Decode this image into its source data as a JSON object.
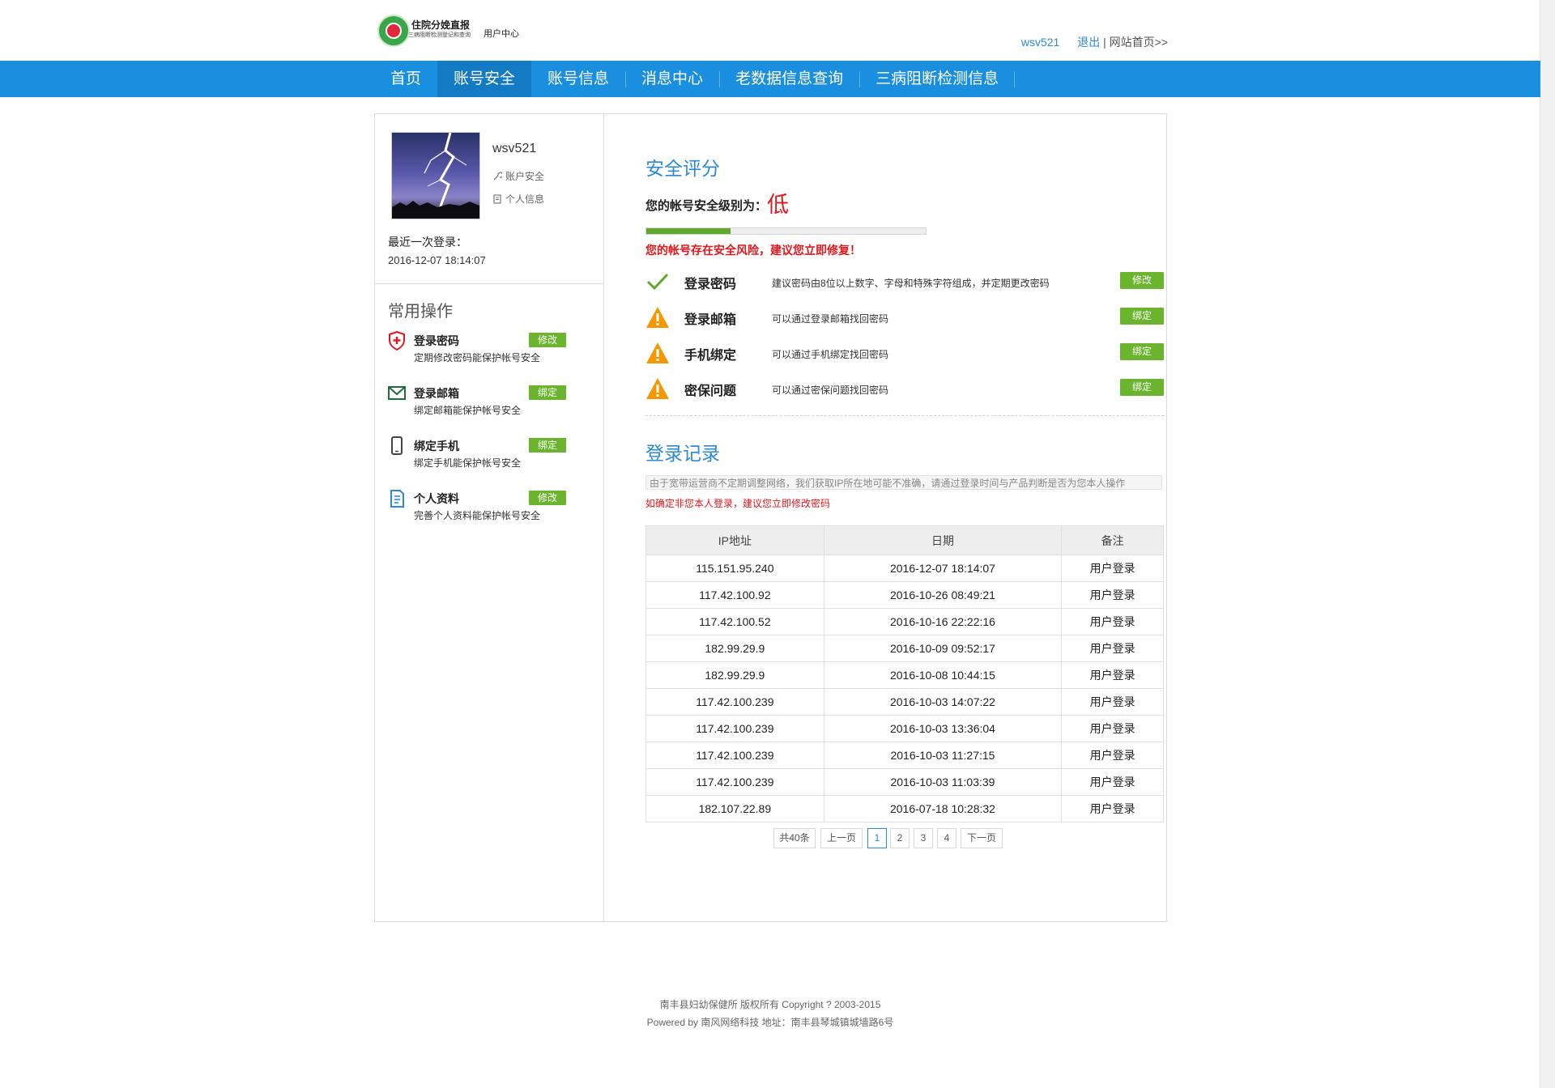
{
  "header": {
    "logo_title": "住院分娩直报",
    "logo_subtitle": "三病阻断检测登记和查询",
    "logo_center": "用户中心",
    "username": "wsv521",
    "logout": "退出",
    "separator": "|",
    "home_link": "网站首页>>"
  },
  "nav": {
    "items": [
      "首页",
      "账号安全",
      "账号信息",
      "消息中心",
      "老数据信息查询",
      "三病阻断检测信息"
    ],
    "active_index": 1
  },
  "sidebar": {
    "username": "wsv521",
    "account_security": "账户安全",
    "personal_info": "个人信息",
    "last_login_label": "最近一次登录：",
    "last_login_time": "2016-12-07 18:14:07",
    "ops_title": "常用操作",
    "ops": [
      {
        "name": "登录密码",
        "desc": "定期修改密码能保护帐号安全",
        "button": "修改",
        "icon": "shield-icon"
      },
      {
        "name": "登录邮箱",
        "desc": "绑定邮箱能保护帐号安全",
        "button": "绑定",
        "icon": "mail-icon"
      },
      {
        "name": "绑定手机",
        "desc": "绑定手机能保护帐号安全",
        "button": "绑定",
        "icon": "phone-icon"
      },
      {
        "name": "个人资料",
        "desc": "完善个人资料能保护帐号安全",
        "button": "修改",
        "icon": "document-icon"
      }
    ]
  },
  "security": {
    "title": "安全评分",
    "level_label": "您的帐号安全级别为：",
    "level_value": "低",
    "progress": 0.3,
    "warning": "您的帐号存在安全风险，建议您立即修复！",
    "items": [
      {
        "name": "登录密码",
        "desc": "建议密码由8位以上数字、字母和特殊字符组成，并定期更改密码",
        "button": "修改",
        "status": "ok"
      },
      {
        "name": "登录邮箱",
        "desc": "可以通过登录邮箱找回密码",
        "button": "绑定",
        "status": "warn"
      },
      {
        "name": "手机绑定",
        "desc": "可以通过手机绑定找回密码",
        "button": "绑定",
        "status": "warn"
      },
      {
        "name": "密保问题",
        "desc": "可以通过密保问题找回密码",
        "button": "绑定",
        "status": "warn"
      }
    ]
  },
  "login_log": {
    "title": "登录记录",
    "notice": "由于宽带运营商不定期调整网络，我们获取IP所在地可能不准确，请通过登录时间与产品判断是否为您本人操作",
    "notice2": "如确定非您本人登录，建议您立即修改密码",
    "columns": [
      "IP地址",
      "日期",
      "备注"
    ],
    "rows": [
      [
        "115.151.95.240",
        "2016-12-07 18:14:07",
        "用户登录"
      ],
      [
        "117.42.100.92",
        "2016-10-26 08:49:21",
        "用户登录"
      ],
      [
        "117.42.100.52",
        "2016-10-16 22:22:16",
        "用户登录"
      ],
      [
        "182.99.29.9",
        "2016-10-09 09:52:17",
        "用户登录"
      ],
      [
        "182.99.29.9",
        "2016-10-08 10:44:15",
        "用户登录"
      ],
      [
        "117.42.100.239",
        "2016-10-03 14:07:22",
        "用户登录"
      ],
      [
        "117.42.100.239",
        "2016-10-03 13:36:04",
        "用户登录"
      ],
      [
        "117.42.100.239",
        "2016-10-03 11:27:15",
        "用户登录"
      ],
      [
        "117.42.100.239",
        "2016-10-03 11:03:39",
        "用户登录"
      ],
      [
        "182.107.22.89",
        "2016-07-18 10:28:32",
        "用户登录"
      ]
    ],
    "pager": {
      "total": "共40条",
      "prev": "上一页",
      "pages": [
        "1",
        "2",
        "3",
        "4"
      ],
      "current": "1",
      "next": "下一页"
    }
  },
  "footer": {
    "line1": "南丰县妇幼保健所   版权所有 Copyright ? 2003-2015",
    "line2": "Powered by 南风网络科技   地址：南丰县琴城镇城墙路6号"
  },
  "colors": {
    "nav_bg": "#1a8fe0",
    "nav_active": "#137ac4",
    "accent_blue": "#2a8ad6",
    "button_green": "#6ab42e",
    "danger_red": "#e4161a",
    "warn_orange": "#f39800"
  }
}
